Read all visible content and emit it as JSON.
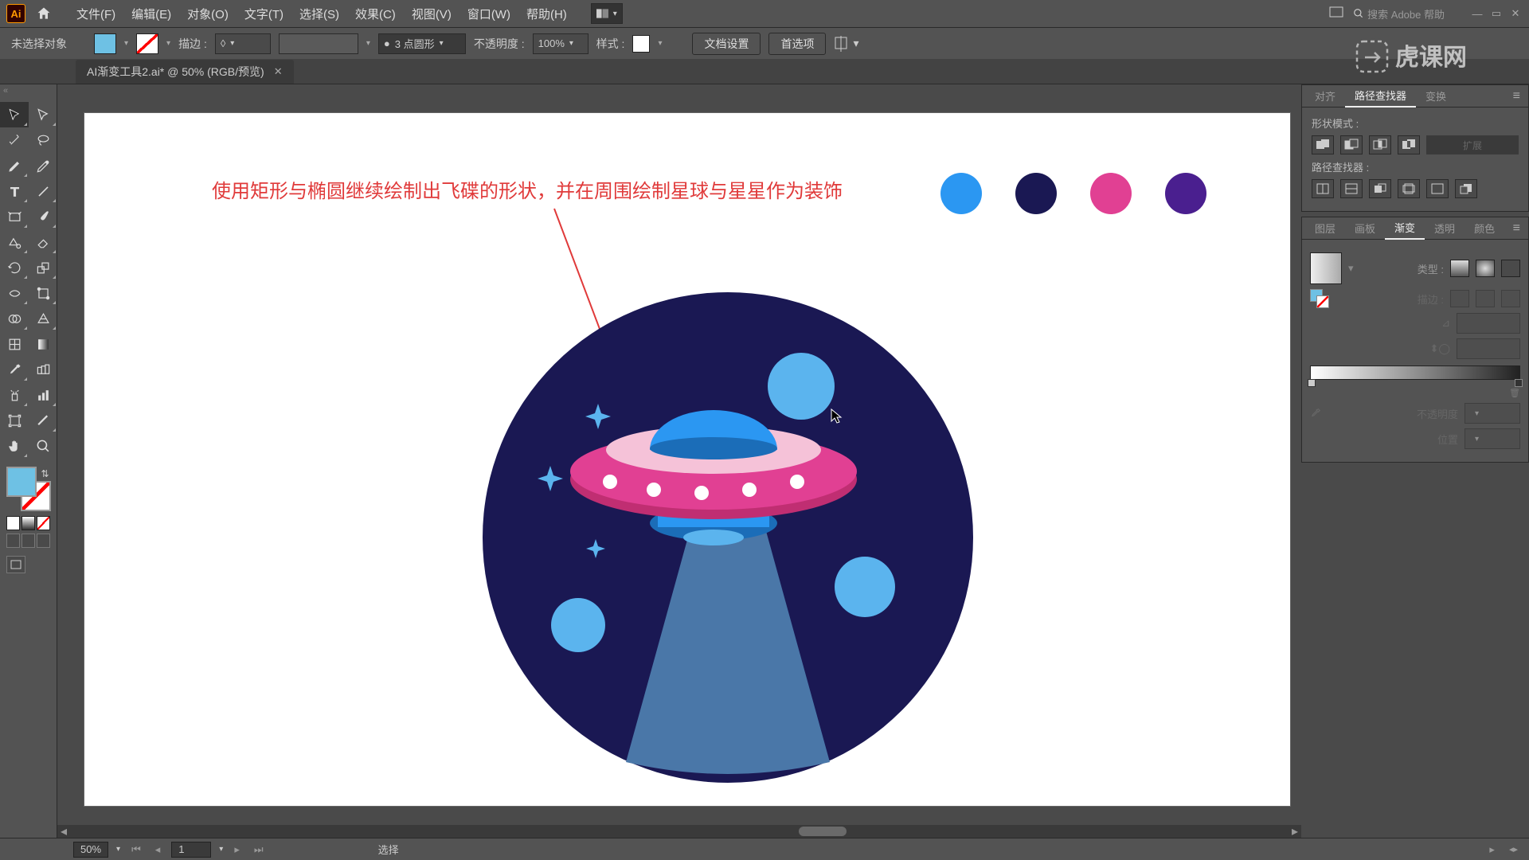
{
  "menu": {
    "file": "文件(F)",
    "edit": "编辑(E)",
    "object": "对象(O)",
    "type": "文字(T)",
    "select": "选择(S)",
    "effect": "效果(C)",
    "view": "视图(V)",
    "window": "窗口(W)",
    "help": "帮助(H)"
  },
  "search_placeholder": "搜索 Adobe 帮助",
  "optbar": {
    "noSelection": "未选择对象",
    "strokeLabel": "描边 :",
    "strokeWidth": "",
    "brush": "3 点圆形",
    "opacityLabel": "不透明度 :",
    "opacityVal": "100%",
    "styleLabel": "样式 :",
    "docSetup": "文档设置",
    "prefs": "首选项"
  },
  "tab": {
    "name": "AI渐变工具2.ai* @ 50% (RGB/预览)"
  },
  "callout_text": "使用矩形与椭圆继续绘制出飞碟的形状，并在周围绘制星球与星星作为装饰",
  "palette": [
    "#2b97f2",
    "#1a1853",
    "#e14093",
    "#4a1f8f"
  ],
  "panels": {
    "align": "对齐",
    "pathfinder": "路径查找器",
    "transform": "变换",
    "shapeModes": "形状模式 :",
    "pathfinders": "路径查找器 :",
    "expand": "扩展",
    "layers": "图层",
    "artboards": "画板",
    "gradient": "渐变",
    "transparency": "透明",
    "color": "颜色",
    "typeLabel": "类型 :",
    "strokeL": "描边 :",
    "angle": "",
    "ratio": "",
    "opacity": "不透明度",
    "location": "位置"
  },
  "status": {
    "zoom": "50%",
    "page": "1",
    "tool": "选择"
  },
  "chart_data": {
    "type": "illustration",
    "description": "Flat UFO illustration inside dark navy circle with light-blue planets, four-point stars, pink saucer body with white dot windows, blue dome and tractor beam."
  }
}
